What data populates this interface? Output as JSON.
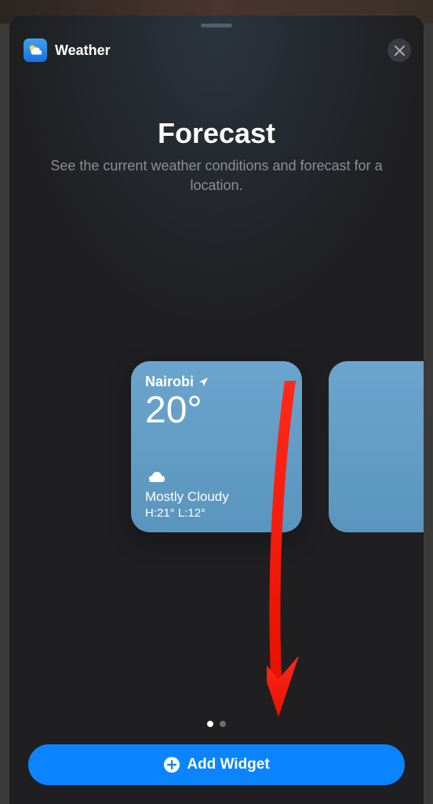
{
  "header": {
    "app_name": "Weather"
  },
  "content": {
    "title": "Forecast",
    "subtitle": "See the current weather conditions and forecast for a location."
  },
  "widget": {
    "location": "Nairobi",
    "temperature": "20°",
    "condition": "Mostly Cloudy",
    "high_low": "H:21° L:12°"
  },
  "pagination": {
    "current": 0,
    "total": 2
  },
  "actions": {
    "add_label": "Add Widget"
  }
}
